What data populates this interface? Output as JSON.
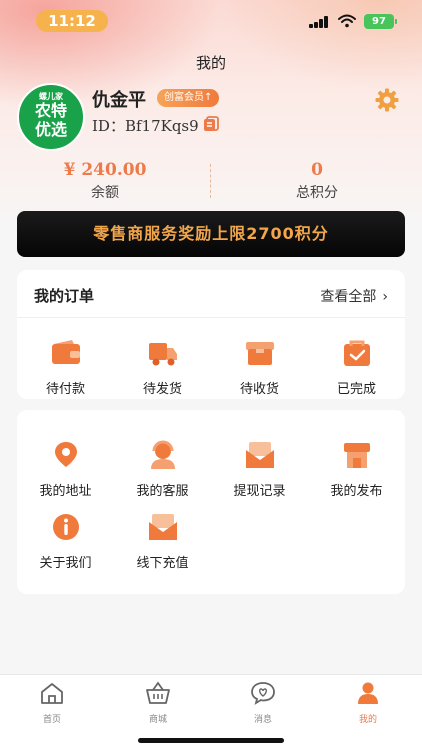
{
  "status_bar": {
    "time": "11:12",
    "battery": "97"
  },
  "page_title": "我的",
  "profile": {
    "logo": {
      "small_text": "螺儿家",
      "line1": "农特",
      "line2": "优选"
    },
    "username": "仇金平",
    "badge": "创富会员↑",
    "id_text": "ID：Bf17Kqs9"
  },
  "stats": {
    "balance_value": "¥ 240.00",
    "balance_label": "余额",
    "points_value": "0",
    "points_label": "总积分"
  },
  "banner": "零售商服务奖励上限2700积分",
  "orders": {
    "title": "我的订单",
    "view_all": "查看全部",
    "items": [
      {
        "label": "待付款",
        "icon": "wallet-icon"
      },
      {
        "label": "待发货",
        "icon": "truck-icon"
      },
      {
        "label": "待收货",
        "icon": "box-icon"
      },
      {
        "label": "已完成",
        "icon": "completed-bag-icon"
      }
    ]
  },
  "services": {
    "items": [
      {
        "label": "我的地址",
        "icon": "location-icon"
      },
      {
        "label": "我的客服",
        "icon": "customer-service-icon"
      },
      {
        "label": "提现记录",
        "icon": "withdraw-envelope-icon"
      },
      {
        "label": "我的发布",
        "icon": "store-icon"
      },
      {
        "label": "关于我们",
        "icon": "info-icon"
      },
      {
        "label": "线下充值",
        "icon": "recharge-envelope-icon"
      }
    ]
  },
  "tabbar": {
    "items": [
      {
        "label": "首页",
        "icon": "home-icon"
      },
      {
        "label": "商城",
        "icon": "basket-icon"
      },
      {
        "label": "消息",
        "icon": "message-icon"
      },
      {
        "label": "我的",
        "icon": "profile-icon",
        "active": true
      }
    ]
  },
  "colors": {
    "accent": "#ec7a4a",
    "icon_orange": "#f07a3c",
    "banner_text": "#f2a64c"
  }
}
